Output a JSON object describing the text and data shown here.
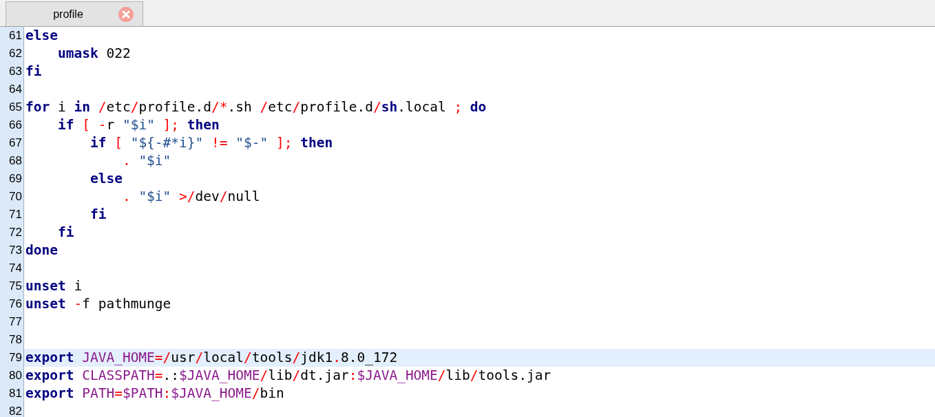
{
  "tab": {
    "label": "profile"
  },
  "lines": [
    {
      "number": "61",
      "selected": false,
      "tokens": [
        {
          "kind": "keyword",
          "text": "else"
        }
      ]
    },
    {
      "number": "62",
      "selected": false,
      "tokens": [
        {
          "kind": "keyword",
          "text": "    umask"
        },
        {
          "kind": "plain",
          "text": " 022"
        }
      ]
    },
    {
      "number": "63",
      "selected": false,
      "tokens": [
        {
          "kind": "keyword",
          "text": "fi"
        }
      ]
    },
    {
      "number": "64",
      "selected": false
    },
    {
      "number": "65",
      "selected": false,
      "tokens": [
        {
          "kind": "keyword",
          "text": "for"
        },
        {
          "kind": "plain",
          "text": " i "
        },
        {
          "kind": "keyword",
          "text": "in"
        },
        {
          "kind": "operator",
          "text": " /"
        },
        {
          "kind": "plain",
          "text": "etc"
        },
        {
          "kind": "operator",
          "text": "/"
        },
        {
          "kind": "plain",
          "text": "profile.d"
        },
        {
          "kind": "operator",
          "text": "/*"
        },
        {
          "kind": "plain",
          "text": ".sh "
        },
        {
          "kind": "operator",
          "text": "/"
        },
        {
          "kind": "plain",
          "text": "etc"
        },
        {
          "kind": "operator",
          "text": "/"
        },
        {
          "kind": "plain",
          "text": "profile.d"
        },
        {
          "kind": "operator",
          "text": "/"
        },
        {
          "kind": "keyword",
          "text": "sh"
        },
        {
          "kind": "plain",
          "text": ".local "
        },
        {
          "kind": "operator",
          "text": "; "
        },
        {
          "kind": "keyword",
          "text": "do"
        }
      ]
    },
    {
      "number": "66",
      "selected": false,
      "tokens": [
        {
          "kind": "keyword",
          "text": "    if"
        },
        {
          "kind": "operator",
          "text": " [ -"
        },
        {
          "kind": "plain",
          "text": "r "
        },
        {
          "kind": "string",
          "text": "\"$i\""
        },
        {
          "kind": "operator",
          "text": " ]; "
        },
        {
          "kind": "keyword",
          "text": "then"
        }
      ]
    },
    {
      "number": "67",
      "selected": false,
      "tokens": [
        {
          "kind": "keyword",
          "text": "        if"
        },
        {
          "kind": "operator",
          "text": " [ "
        },
        {
          "kind": "string",
          "text": "\"${-#*i}\""
        },
        {
          "kind": "operator",
          "text": " != "
        },
        {
          "kind": "string",
          "text": "\"$-\""
        },
        {
          "kind": "operator",
          "text": " ]; "
        },
        {
          "kind": "keyword",
          "text": "then"
        }
      ]
    },
    {
      "number": "68",
      "selected": false,
      "tokens": [
        {
          "kind": "operator",
          "text": "            . "
        },
        {
          "kind": "string",
          "text": "\"$i\""
        }
      ]
    },
    {
      "number": "69",
      "selected": false,
      "tokens": [
        {
          "kind": "keyword",
          "text": "        else"
        }
      ]
    },
    {
      "number": "70",
      "selected": false,
      "tokens": [
        {
          "kind": "operator",
          "text": "            . "
        },
        {
          "kind": "string",
          "text": "\"$i\""
        },
        {
          "kind": "operator",
          "text": " >/"
        },
        {
          "kind": "plain",
          "text": "dev"
        },
        {
          "kind": "operator",
          "text": "/"
        },
        {
          "kind": "plain",
          "text": "null"
        }
      ]
    },
    {
      "number": "71",
      "selected": false,
      "tokens": [
        {
          "kind": "keyword",
          "text": "        fi"
        }
      ]
    },
    {
      "number": "72",
      "selected": false,
      "tokens": [
        {
          "kind": "keyword",
          "text": "    fi"
        }
      ]
    },
    {
      "number": "73",
      "selected": false,
      "tokens": [
        {
          "kind": "keyword",
          "text": "done"
        }
      ]
    },
    {
      "number": "74",
      "selected": false
    },
    {
      "number": "75",
      "selected": false,
      "tokens": [
        {
          "kind": "keyword",
          "text": "unset"
        },
        {
          "kind": "plain",
          "text": " i"
        }
      ]
    },
    {
      "number": "76",
      "selected": false,
      "tokens": [
        {
          "kind": "keyword",
          "text": "unset"
        },
        {
          "kind": "operator",
          "text": " -"
        },
        {
          "kind": "plain",
          "text": "f pathmunge"
        }
      ]
    },
    {
      "number": "77",
      "selected": false
    },
    {
      "number": "78",
      "selected": false
    },
    {
      "number": "79",
      "selected": true,
      "tokens": [
        {
          "kind": "keyword",
          "text": "export"
        },
        {
          "kind": "variable",
          "text": " JAVA_HOME"
        },
        {
          "kind": "operator",
          "text": "=/"
        },
        {
          "kind": "plain",
          "text": "usr"
        },
        {
          "kind": "operator",
          "text": "/"
        },
        {
          "kind": "plain",
          "text": "local"
        },
        {
          "kind": "operator",
          "text": "/"
        },
        {
          "kind": "plain",
          "text": "tools"
        },
        {
          "kind": "operator",
          "text": "/"
        },
        {
          "kind": "plain",
          "text": "jdk1"
        },
        {
          "kind": "operator",
          "text": "."
        },
        {
          "kind": "plain",
          "text": "8.0_172"
        }
      ]
    },
    {
      "number": "80",
      "selected": false,
      "tokens": [
        {
          "kind": "keyword",
          "text": "export"
        },
        {
          "kind": "variable",
          "text": " CLASSPATH"
        },
        {
          "kind": "operator",
          "text": "="
        },
        {
          "kind": "plain",
          "text": ".:"
        },
        {
          "kind": "variable",
          "text": "$JAVA_HOME"
        },
        {
          "kind": "operator",
          "text": "/"
        },
        {
          "kind": "plain",
          "text": "lib"
        },
        {
          "kind": "operator",
          "text": "/"
        },
        {
          "kind": "plain",
          "text": "dt.jar"
        },
        {
          "kind": "operator",
          "text": ":"
        },
        {
          "kind": "variable",
          "text": "$JAVA_HOME"
        },
        {
          "kind": "operator",
          "text": "/"
        },
        {
          "kind": "plain",
          "text": "lib"
        },
        {
          "kind": "operator",
          "text": "/"
        },
        {
          "kind": "plain",
          "text": "tools.jar"
        }
      ]
    },
    {
      "number": "81",
      "selected": false,
      "tokens": [
        {
          "kind": "keyword",
          "text": "export"
        },
        {
          "kind": "variable",
          "text": " PATH"
        },
        {
          "kind": "operator",
          "text": "="
        },
        {
          "kind": "variable",
          "text": "$PATH"
        },
        {
          "kind": "operator",
          "text": ":"
        },
        {
          "kind": "variable",
          "text": "$JAVA_HOME"
        },
        {
          "kind": "operator",
          "text": "/"
        },
        {
          "kind": "plain",
          "text": "bin"
        }
      ]
    },
    {
      "number": "82",
      "selected": false
    }
  ]
}
